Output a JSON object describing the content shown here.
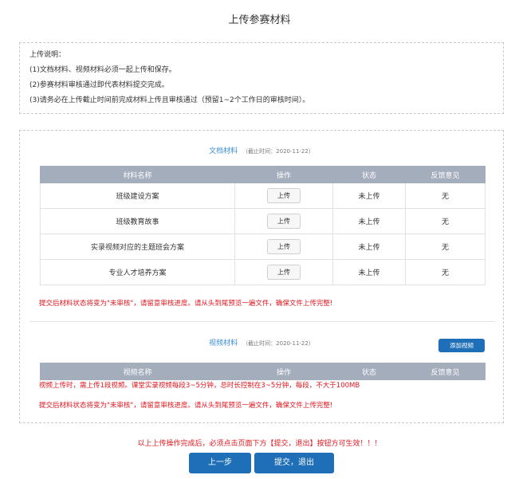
{
  "page": {
    "title": "上传参赛材料"
  },
  "instructions": {
    "heading": "上传说明：",
    "lines": [
      "(1)文档材料、视频材料必须一起上传和保存。",
      "(2)参赛材料审核通过即代表材料提交完成。",
      "(3)请务必在上传截止时间前完成材料上传且审核通过（预留1~2个工作日的审核时间）。"
    ]
  },
  "documents": {
    "title": "文档材料",
    "deadline": "（截止时间：2020-11-22）",
    "columns": [
      "材料名称",
      "操作",
      "状态",
      "反馈意见"
    ],
    "upload_label": "上传",
    "rows": [
      {
        "name": "班级建设方案",
        "status": "未上传",
        "feedback": "无"
      },
      {
        "name": "班级教育故事",
        "status": "未上传",
        "feedback": "无"
      },
      {
        "name": "实录视频对应的主题班会方案",
        "status": "未上传",
        "feedback": "无"
      },
      {
        "name": "专业人才培养方案",
        "status": "未上传",
        "feedback": "无"
      }
    ],
    "warning": "提交后材料状态将变为\"未审核\"，请留意审核进度。请从头到尾预览一遍文件，确保文件上传完整!"
  },
  "videos": {
    "title": "视频材料",
    "deadline": "（截止时间：2020-11-22）",
    "add_button": "添加视频",
    "columns": [
      "视频名称",
      "操作",
      "状态",
      "反馈意见"
    ],
    "note": "视频上传时，需上传1段视频。课堂实录视频每段3~5分钟，总时长控制在3~5分钟，每段，不大于100MB",
    "warning": "提交后材料状态将变为\"未审核\"，请留意审核进度。请从头到尾预览一遍文件，确保文件上传完整!"
  },
  "footer": {
    "warning": "以上上传操作完成后，必须点击页面下方【提交，退出】按钮方可生效！！！",
    "prev_label": "上一步",
    "submit_label": "提交，退出"
  },
  "colors": {
    "accent": "#1e6fb8",
    "title_blue": "#3b8ed4",
    "warning_red": "#e0161e",
    "header_gray": "#a4adbc"
  }
}
